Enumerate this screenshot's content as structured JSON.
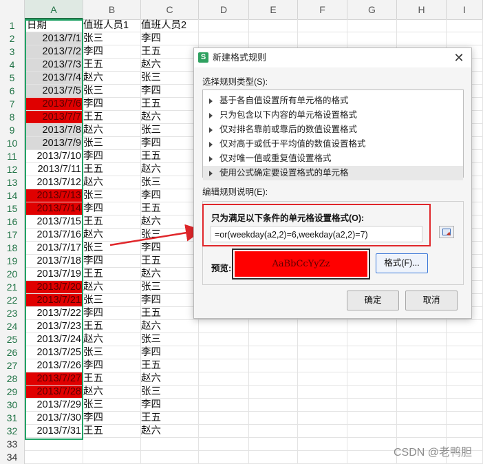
{
  "sheet": {
    "columns": [
      "A",
      "B",
      "C",
      "D",
      "E",
      "F",
      "G",
      "H",
      "I"
    ],
    "selected_column": "A",
    "header_row": {
      "row": "1",
      "a": "日期",
      "b": "值班人员1",
      "c": "值班人员2"
    },
    "rows": [
      {
        "row": "2",
        "date": "2013/7/1",
        "p1": "张三",
        "p2": "李四",
        "fill": "grey"
      },
      {
        "row": "3",
        "date": "2013/7/2",
        "p1": "李四",
        "p2": "王五",
        "fill": "grey"
      },
      {
        "row": "4",
        "date": "2013/7/3",
        "p1": "王五",
        "p2": "赵六",
        "fill": "grey"
      },
      {
        "row": "5",
        "date": "2013/7/4",
        "p1": "赵六",
        "p2": "张三",
        "fill": "grey"
      },
      {
        "row": "6",
        "date": "2013/7/5",
        "p1": "张三",
        "p2": "李四",
        "fill": "grey"
      },
      {
        "row": "7",
        "date": "2013/7/6",
        "p1": "李四",
        "p2": "王五",
        "fill": "red"
      },
      {
        "row": "8",
        "date": "2013/7/7",
        "p1": "王五",
        "p2": "赵六",
        "fill": "red"
      },
      {
        "row": "9",
        "date": "2013/7/8",
        "p1": "赵六",
        "p2": "张三",
        "fill": "grey"
      },
      {
        "row": "10",
        "date": "2013/7/9",
        "p1": "张三",
        "p2": "李四",
        "fill": "grey"
      },
      {
        "row": "11",
        "date": "2013/7/10",
        "p1": "李四",
        "p2": "王五",
        "fill": "none"
      },
      {
        "row": "12",
        "date": "2013/7/11",
        "p1": "王五",
        "p2": "赵六",
        "fill": "none"
      },
      {
        "row": "13",
        "date": "2013/7/12",
        "p1": "赵六",
        "p2": "张三",
        "fill": "none"
      },
      {
        "row": "14",
        "date": "2013/7/13",
        "p1": "张三",
        "p2": "李四",
        "fill": "red"
      },
      {
        "row": "15",
        "date": "2013/7/14",
        "p1": "李四",
        "p2": "王五",
        "fill": "red"
      },
      {
        "row": "16",
        "date": "2013/7/15",
        "p1": "王五",
        "p2": "赵六",
        "fill": "none"
      },
      {
        "row": "17",
        "date": "2013/7/16",
        "p1": "赵六",
        "p2": "张三",
        "fill": "none"
      },
      {
        "row": "18",
        "date": "2013/7/17",
        "p1": "张三",
        "p2": "李四",
        "fill": "none"
      },
      {
        "row": "19",
        "date": "2013/7/18",
        "p1": "李四",
        "p2": "王五",
        "fill": "none"
      },
      {
        "row": "20",
        "date": "2013/7/19",
        "p1": "王五",
        "p2": "赵六",
        "fill": "none"
      },
      {
        "row": "21",
        "date": "2013/7/20",
        "p1": "赵六",
        "p2": "张三",
        "fill": "red"
      },
      {
        "row": "22",
        "date": "2013/7/21",
        "p1": "张三",
        "p2": "李四",
        "fill": "red"
      },
      {
        "row": "23",
        "date": "2013/7/22",
        "p1": "李四",
        "p2": "王五",
        "fill": "none"
      },
      {
        "row": "24",
        "date": "2013/7/23",
        "p1": "王五",
        "p2": "赵六",
        "fill": "none"
      },
      {
        "row": "25",
        "date": "2013/7/24",
        "p1": "赵六",
        "p2": "张三",
        "fill": "none"
      },
      {
        "row": "26",
        "date": "2013/7/25",
        "p1": "张三",
        "p2": "李四",
        "fill": "none"
      },
      {
        "row": "27",
        "date": "2013/7/26",
        "p1": "李四",
        "p2": "王五",
        "fill": "none"
      },
      {
        "row": "28",
        "date": "2013/7/27",
        "p1": "王五",
        "p2": "赵六",
        "fill": "red"
      },
      {
        "row": "29",
        "date": "2013/7/28",
        "p1": "赵六",
        "p2": "张三",
        "fill": "red"
      },
      {
        "row": "30",
        "date": "2013/7/29",
        "p1": "张三",
        "p2": "李四",
        "fill": "none"
      },
      {
        "row": "31",
        "date": "2013/7/30",
        "p1": "李四",
        "p2": "王五",
        "fill": "none"
      },
      {
        "row": "32",
        "date": "2013/7/31",
        "p1": "王五",
        "p2": "赵六",
        "fill": "none"
      }
    ],
    "empty_rows": [
      "33",
      "34"
    ]
  },
  "dialog": {
    "title": "新建格式规则",
    "close_glyph": "✕",
    "app_icon_glyph": "S",
    "rule_type_label": "选择规则类型(S):",
    "rule_types": [
      "基于各自值设置所有单元格的格式",
      "只为包含以下内容的单元格设置格式",
      "仅对排名靠前或靠后的数值设置格式",
      "仅对高于或低于平均值的数值设置格式",
      "仅对唯一值或重复值设置格式",
      "使用公式确定要设置格式的单元格"
    ],
    "selected_rule_index": 5,
    "edit_label": "编辑规则说明(E):",
    "condition_label": "只为满足以下条件的单元格设置格式(O):",
    "formula": "=or(weekday(a2,2)=6,weekday(a2,2)=7)",
    "preview_label": "预览:",
    "preview_text": "AaBbCcYyZz",
    "format_button": "格式(F)...",
    "ok_button": "确定",
    "cancel_button": "取消"
  },
  "watermark": "CSDN @老鸭胆",
  "colors": {
    "accent_green": "#217346",
    "highlight_red": "#e00000",
    "callout_red": "#e0262a"
  }
}
